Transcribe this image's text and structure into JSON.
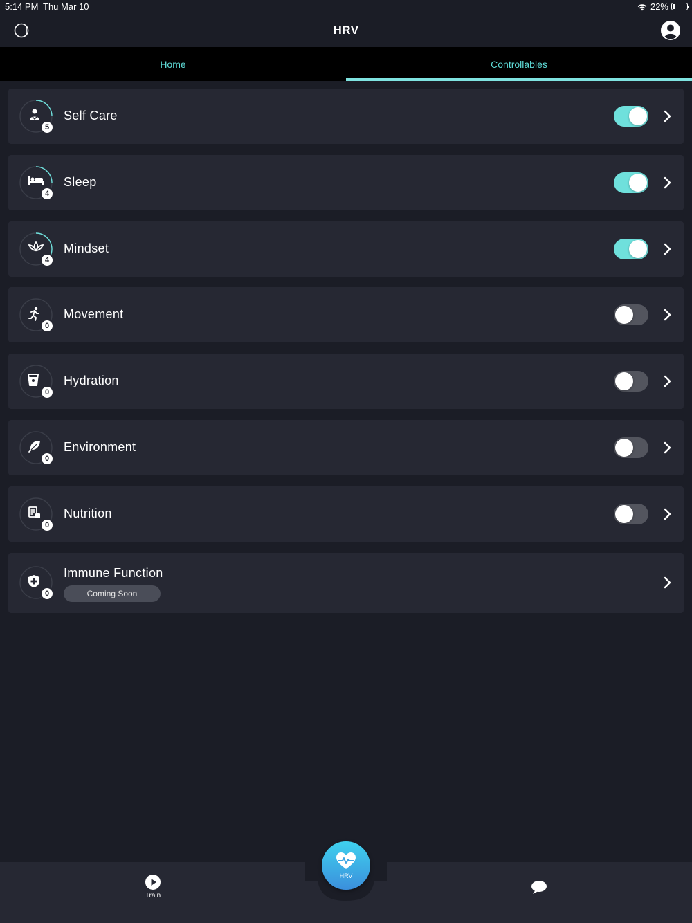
{
  "status_bar": {
    "time": "5:14 PM",
    "date": "Thu Mar 10",
    "battery": "22%",
    "battery_level": 0.22
  },
  "header": {
    "title": "HRV",
    "logo_icon": "app-logo-icon",
    "profile_icon": "user-profile-icon"
  },
  "tabs": [
    {
      "label": "Home",
      "active": false
    },
    {
      "label": "Controllables",
      "active": true
    }
  ],
  "controllables": [
    {
      "label": "Self Care",
      "count": "5",
      "enabled": true,
      "icon": "self-care-icon",
      "progress": 0.25
    },
    {
      "label": "Sleep",
      "count": "4",
      "enabled": true,
      "icon": "bed-icon",
      "progress": 0.25
    },
    {
      "label": "Mindset",
      "count": "4",
      "enabled": true,
      "icon": "lotus-icon",
      "progress": 0.4
    },
    {
      "label": "Movement",
      "count": "0",
      "enabled": false,
      "icon": "running-icon",
      "progress": 0
    },
    {
      "label": "Hydration",
      "count": "0",
      "enabled": false,
      "icon": "water-glass-icon",
      "progress": 0
    },
    {
      "label": "Environment",
      "count": "0",
      "enabled": false,
      "icon": "leaf-icon",
      "progress": 0
    },
    {
      "label": "Nutrition",
      "count": "0",
      "enabled": false,
      "icon": "nutrition-icon",
      "progress": 0
    },
    {
      "label": "Immune Function",
      "count": "0",
      "icon": "shield-plus-icon",
      "progress": 0,
      "badge": "Coming Soon"
    }
  ],
  "bottom_nav": {
    "train_label": "Train",
    "hrv_label": "HRV"
  },
  "colors": {
    "background": "#1b1d26",
    "card": "#262833",
    "accent": "#6fe0dc",
    "tab_text": "#5fdcd8"
  }
}
